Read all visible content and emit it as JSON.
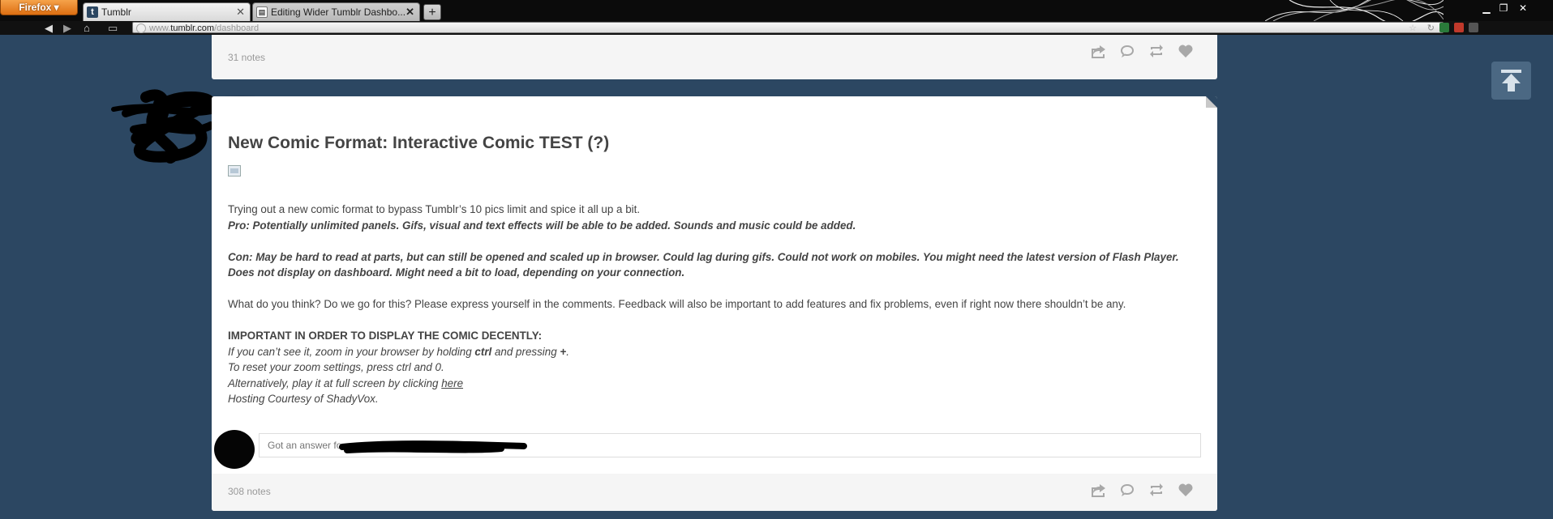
{
  "browser": {
    "app_button": "Firefox",
    "tabs": [
      {
        "title": "Tumblr",
        "favicon": "t",
        "active": true
      },
      {
        "title": "Editing Wider Tumblr Dashbo...",
        "active": false
      }
    ],
    "new_tab_label": "+",
    "url_prefix": "www.",
    "url_domain": "tumblr.com",
    "url_path": "/dashboard"
  },
  "dashboard": {
    "previous_post": {
      "notes": "31 notes"
    },
    "post": {
      "title": "New Comic Format: Interactive Comic TEST (?)",
      "intro": "Trying out a new comic format to bypass Tumblr’s 10 pics limit and spice it all up a bit.",
      "pro": "Pro: Potentially unlimited panels. Gifs, visual and text effects will be able to be added. Sounds and music could be added.",
      "con": "Con: May be hard to read at parts, but can still be opened and scaled up in browser. Could lag during gifs. Could not work on mobiles. You might need the latest version of Flash Player.",
      "con2": "Does not display on dashboard. Might need a bit to load, depending on your connection.",
      "question": "What do you think? Do we go for this? Please express yourself in the comments. Feedback will also be important to add features and fix problems, even if right now there shouldn’t be any.",
      "important_heading": "IMPORTANT IN ORDER TO DISPLAY THE COMIC DECENTLY:",
      "zoom_a": "If you can’t see it, zoom in your browser by holding ",
      "zoom_ctrl": "ctrl",
      "zoom_b": " and pressing ",
      "zoom_plus": "+",
      "zoom_c": ".",
      "reset": "To reset your zoom settings, press ctrl and 0.",
      "alt_a": "Alternatively, play it at full screen by clicking ",
      "alt_link": "here",
      "hosting": "Hosting Courtesy of ShadyVox.",
      "reply_placeholder": "Got an answer fo",
      "notes": "308 notes"
    }
  },
  "colors": {
    "dashboard_bg": "#2c4762",
    "post_bg": "#ffffff",
    "footer_bg": "#f5f5f5",
    "text": "#444444",
    "muted": "#999999",
    "icon": "#a8a8a8"
  },
  "icons": [
    "share-icon",
    "reply-icon",
    "reblog-icon",
    "like-icon",
    "scroll-to-top-icon",
    "back-icon",
    "forward-icon",
    "home-icon"
  ]
}
